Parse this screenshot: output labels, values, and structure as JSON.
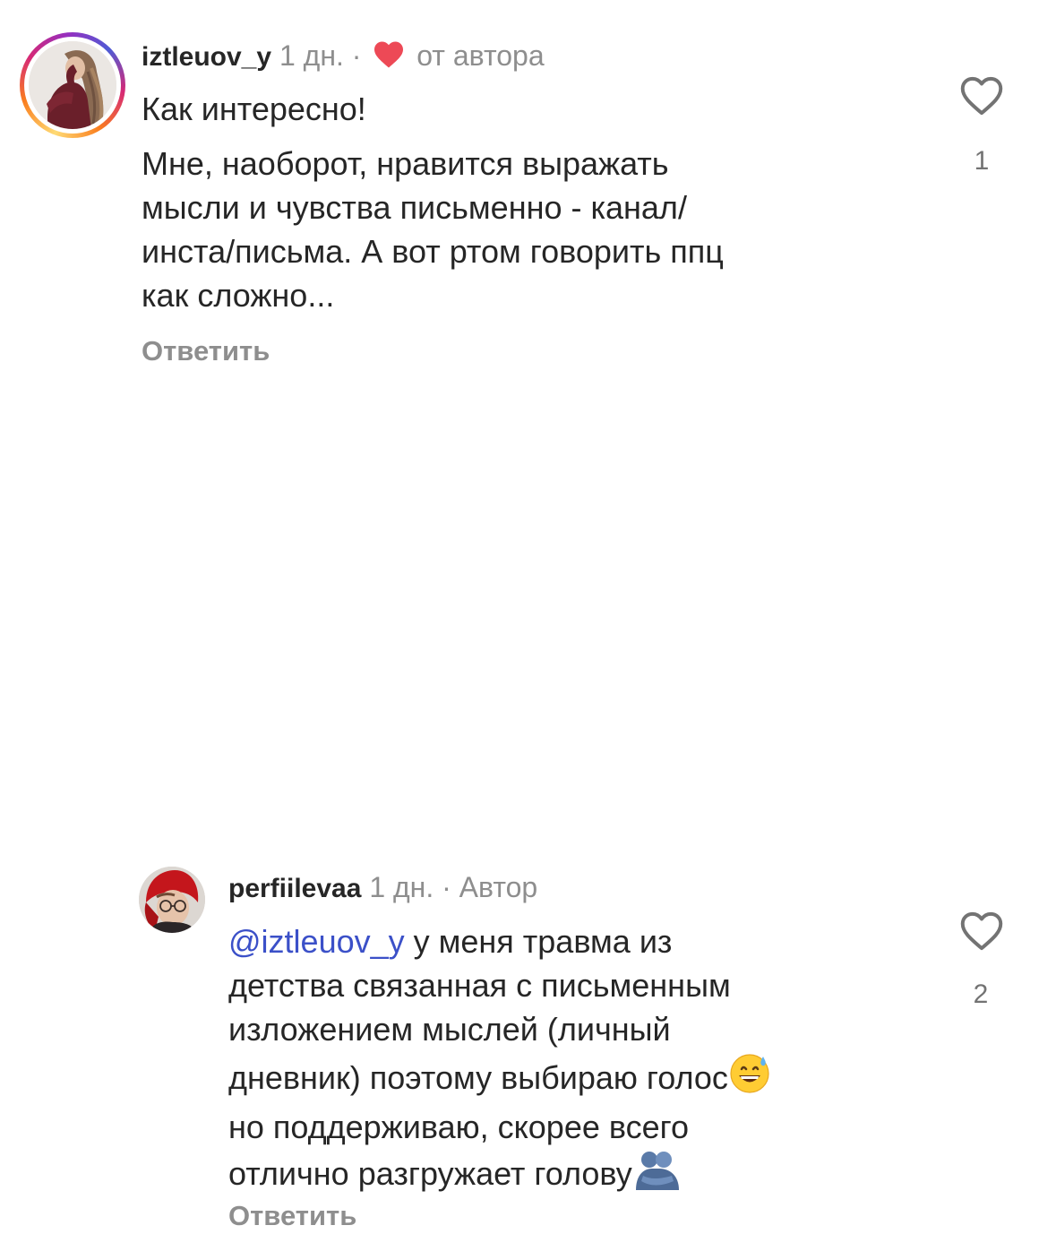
{
  "comments": [
    {
      "username": "iztleuov_y",
      "time": "1 дн.",
      "separator": "·",
      "badge": "от автора",
      "text_lines": [
        "Как интересно!",
        "Мне, наоборот, нравится выражать",
        "мысли и чувства письменно - канал/",
        "инста/письма. А вот ртом говорить ппц",
        "как сложно..."
      ],
      "reply_label": "Ответить",
      "likes": "1",
      "avatar": "woman-with-long-wavy-hair-photo",
      "story_ring": true
    },
    {
      "username": "perfiilevaa",
      "time": "1 дн.",
      "separator": "·",
      "badge": "Автор",
      "mention": "@iztleuov_y",
      "text_first_rest": " у меня травма из",
      "text_lines": [
        "детства связанная с письменным",
        "изложением мыслей (личный",
        "дневник) поэтому выбираю голос",
        "но поддерживаю, скорее всего",
        "отлично разгружает голову"
      ],
      "emojis": [
        "grinning-face-with-sweat-emoji",
        "people-hugging-emoji"
      ],
      "reply_label": "Ответить",
      "likes": "2",
      "avatar": "person-in-red-headscarf-with-glasses-photo",
      "story_ring": false
    }
  ],
  "colors": {
    "text": "#262626",
    "meta": "#8e8e8e",
    "mention": "#3b50c8",
    "heart": "#ed4956",
    "count": "#737373"
  },
  "icons": {
    "like": "heart-outline-icon",
    "creator_liked": "heart-filled-icon"
  }
}
